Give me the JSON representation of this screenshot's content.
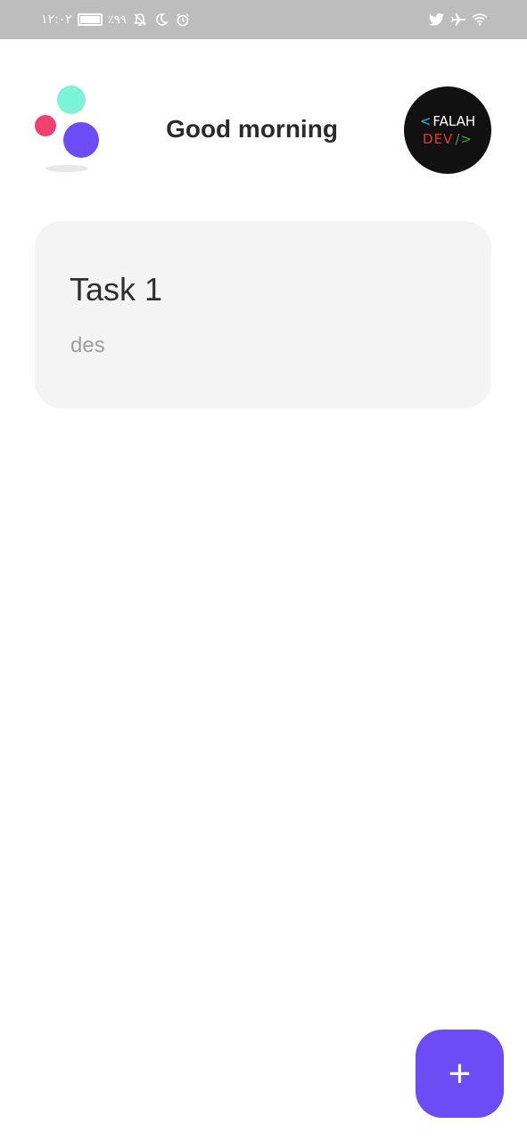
{
  "status_bar": {
    "time": "١٢:٠٢",
    "battery_percent": "٪٩٩",
    "icons_left": [
      "battery-icon",
      "bell-off-icon",
      "moon-icon",
      "alarm-icon"
    ],
    "icons_right": [
      "twitter-icon",
      "airplane-icon",
      "wifi-icon"
    ]
  },
  "header": {
    "greeting": "Good morning",
    "avatar": {
      "line1": "FALAH",
      "line2": "DEV",
      "open": "<",
      "close": "/>"
    }
  },
  "tasks": [
    {
      "title": "Task 1",
      "description": "des"
    }
  ],
  "fab": {
    "label": "+"
  },
  "colors": {
    "accent": "#6c4cf5",
    "logo_teal": "#7af3d6",
    "logo_pink": "#f0416f",
    "logo_purple": "#6c4cf5",
    "card_bg": "#f4f4f4"
  }
}
